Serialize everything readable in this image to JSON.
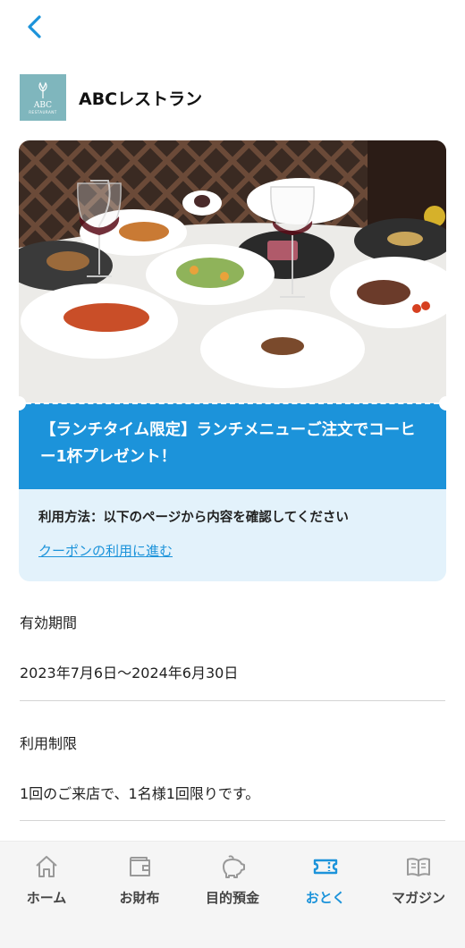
{
  "shop": {
    "name": "ABCレストラン",
    "logo_text": "ABC",
    "logo_sub": "RESTAURANT"
  },
  "coupon": {
    "title": "【ランチタイム限定】ランチメニューご注文でコーヒー1杯プレゼント！",
    "usage": "利用方法：以下のページから内容を確認してください",
    "link_label": "クーポンの利用に進む"
  },
  "validity": {
    "label": "有効期間",
    "value": "2023年7月6日〜2024年6月30日"
  },
  "restriction": {
    "label": "利用制限",
    "value": "1回のご来店で、1名様1回限りです。"
  },
  "tabs": [
    {
      "label": "ホーム",
      "icon": "home-icon"
    },
    {
      "label": "お財布",
      "icon": "wallet-icon"
    },
    {
      "label": "目的預金",
      "icon": "piggy-bank-icon"
    },
    {
      "label": "おとく",
      "icon": "ticket-icon",
      "active": true
    },
    {
      "label": "マガジン",
      "icon": "book-icon"
    }
  ],
  "colors": {
    "accent": "#1c93da",
    "coupon_body": "#e3f2fb",
    "logo_bg": "#7fb6bd"
  }
}
